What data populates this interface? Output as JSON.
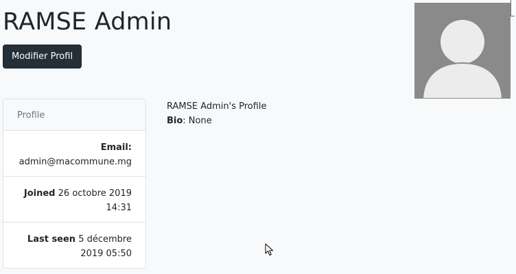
{
  "header": {
    "title": "RAMSE Admin",
    "edit_button_label": "Modifier Profil"
  },
  "avatar": {
    "icon": "default-user-avatar-icon",
    "background_color": "#8a8a8a",
    "figure_color": "#ececec"
  },
  "profile_card": {
    "header": "Profile",
    "email_label": "Email:",
    "email_value": "admin@macommune.mg",
    "joined_label": "Joined",
    "joined_value_line1": "26 octobre 2019",
    "joined_value_line2": "14:31",
    "last_seen_label": "Last seen",
    "last_seen_value_line1": "5 décembre",
    "last_seen_value_line2": "2019 05:50"
  },
  "main": {
    "profile_heading": "RAMSE Admin's Profile",
    "bio_label": "Bio",
    "bio_value": ": None"
  },
  "colors": {
    "page_background": "#f8f9fb",
    "button_background": "#252f37",
    "card_border": "#dfe2e6"
  }
}
